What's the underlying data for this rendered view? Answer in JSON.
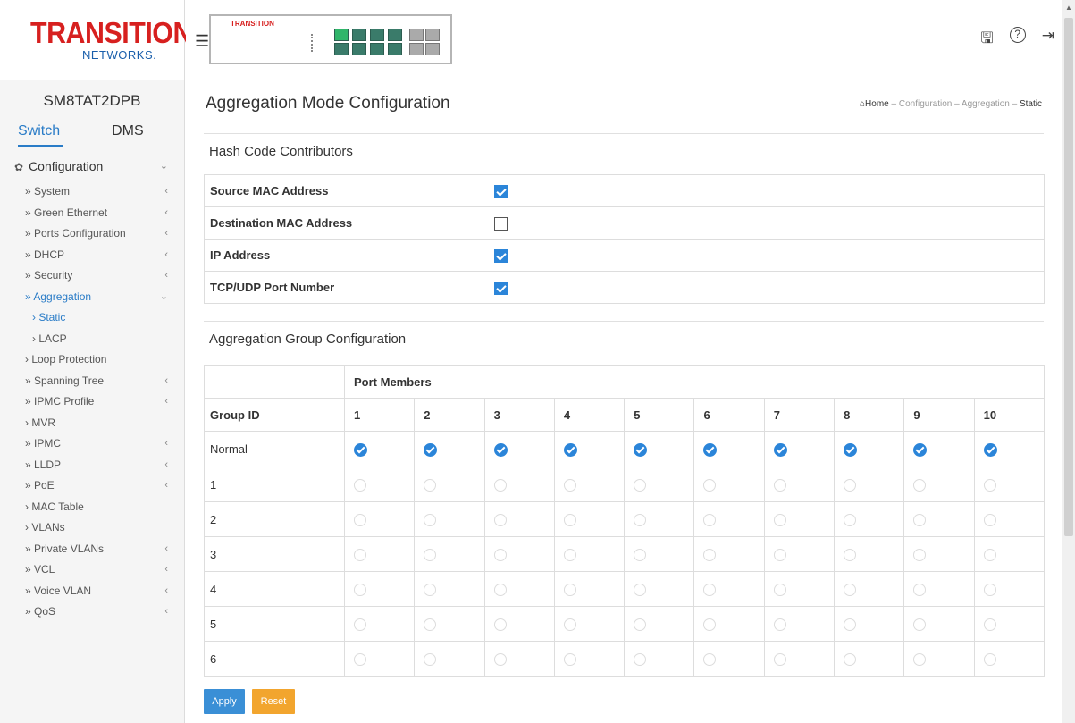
{
  "brand": {
    "name": "TRANSITION",
    "sub": "NETWORKS.",
    "panel_logo": "TRANSITION"
  },
  "device": {
    "name": "SM8TAT2DPB"
  },
  "tabs": [
    {
      "label": "Switch"
    },
    {
      "label": "DMS"
    }
  ],
  "sidebar": {
    "config_label": "Configuration",
    "items": [
      {
        "label": "» System",
        "chevron": "‹"
      },
      {
        "label": "» Green Ethernet",
        "chevron": "‹"
      },
      {
        "label": "» Ports Configuration",
        "chevron": "‹"
      },
      {
        "label": "» DHCP",
        "chevron": "‹"
      },
      {
        "label": "» Security",
        "chevron": "‹"
      },
      {
        "label": "» Aggregation",
        "chevron": "⌄"
      },
      {
        "label": "› Static",
        "chevron": ""
      },
      {
        "label": "› LACP",
        "chevron": ""
      },
      {
        "label": "› Loop Protection",
        "chevron": ""
      },
      {
        "label": "» Spanning Tree",
        "chevron": "‹"
      },
      {
        "label": "» IPMC Profile",
        "chevron": "‹"
      },
      {
        "label": "› MVR",
        "chevron": ""
      },
      {
        "label": "» IPMC",
        "chevron": "‹"
      },
      {
        "label": "» LLDP",
        "chevron": "‹"
      },
      {
        "label": "» PoE",
        "chevron": "‹"
      },
      {
        "label": "› MAC Table",
        "chevron": ""
      },
      {
        "label": "› VLANs",
        "chevron": ""
      },
      {
        "label": "» Private VLANs",
        "chevron": "‹"
      },
      {
        "label": "» VCL",
        "chevron": "‹"
      },
      {
        "label": "» Voice VLAN",
        "chevron": "‹"
      },
      {
        "label": "» QoS",
        "chevron": "‹"
      }
    ]
  },
  "header": {
    "icons": [
      "save-icon",
      "help-icon",
      "logout-icon"
    ]
  },
  "page": {
    "title": "Aggregation Mode Configuration",
    "breadcrumb": [
      "Home",
      "Configuration",
      "Aggregation",
      "Static"
    ]
  },
  "hash": {
    "title": "Hash Code Contributors",
    "rows": [
      {
        "label": "Source MAC Address",
        "checked": true
      },
      {
        "label": "Destination MAC Address",
        "checked": false
      },
      {
        "label": "IP Address",
        "checked": true
      },
      {
        "label": "TCP/UDP Port Number",
        "checked": true
      }
    ]
  },
  "agg": {
    "title": "Aggregation Group Configuration",
    "port_members_label": "Port Members",
    "group_id_label": "Group ID",
    "ports": [
      "1",
      "2",
      "3",
      "4",
      "5",
      "6",
      "7",
      "8",
      "9",
      "10"
    ],
    "groups": [
      "Normal",
      "1",
      "2",
      "3",
      "4",
      "5",
      "6"
    ],
    "selected_group": "Normal"
  },
  "buttons": {
    "apply": "Apply",
    "reset": "Reset"
  },
  "colors": {
    "accent": "#2b85d9",
    "brand_red": "#d7201f",
    "reset": "#f2a52e"
  }
}
